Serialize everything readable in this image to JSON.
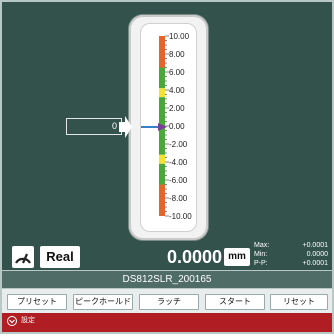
{
  "gauge": {
    "ticks": [
      "10.00",
      "8.00",
      "6.00",
      "4.00",
      "2.00",
      "0.00",
      "-2.00",
      "-4.00",
      "-6.00",
      "-8.00",
      "-10.00"
    ],
    "current_value": 0,
    "colors": {
      "high_zone": "#e8632b",
      "warn_zone": "#f2e233",
      "ok_zone": "#4aa83a",
      "needle": "#3b7fc4"
    }
  },
  "pointer_input": {
    "value": "0"
  },
  "readout": {
    "mode_icon": "gauge-icon",
    "mode_label": "Real",
    "value": "0.0000",
    "unit": "mm",
    "max_label": "Max:",
    "max_value": "+0.0001",
    "min_label": "Min:",
    "min_value": "0.0000",
    "pp_label": "P-P:",
    "pp_value": "+0.0001"
  },
  "device": {
    "name": "DS812SLR_200165"
  },
  "buttons": {
    "preset": "プリセット",
    "peak_hold": "ピークホールド",
    "latch": "ラッチ",
    "start": "スタート",
    "reset": "リセット"
  },
  "settings": {
    "label": "設定",
    "icon": "chevron-down-icon"
  },
  "theme": {
    "background": "#33524c",
    "accent": "#b01e23"
  }
}
